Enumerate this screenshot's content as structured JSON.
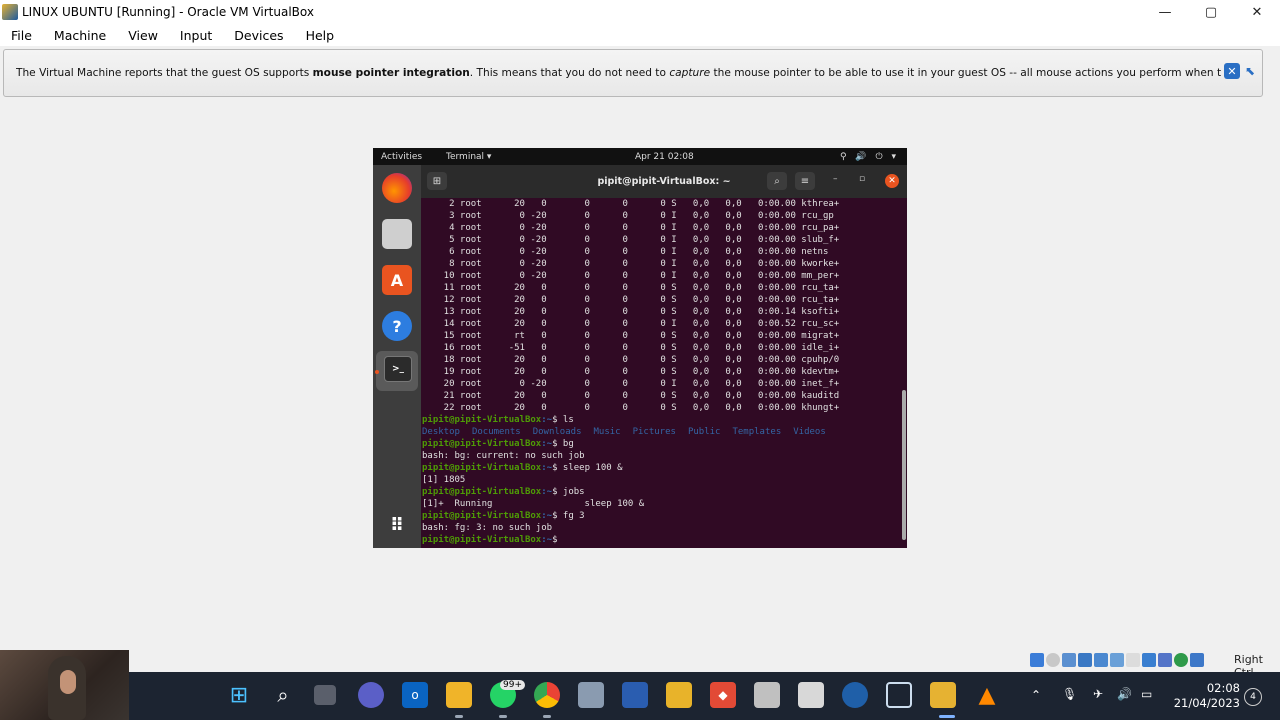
{
  "window": {
    "title": "LINUX UBUNTU [Running] - Oracle VM VirtualBox",
    "controls": [
      "—",
      "▢",
      "✕"
    ]
  },
  "menu": [
    "File",
    "Machine",
    "View",
    "Input",
    "Devices",
    "Help"
  ],
  "notification": {
    "part1": "The Virtual Machine reports that the guest OS supports ",
    "bold": "mouse pointer integration",
    "part2": ". This means that you do not need to ",
    "italic": "capture",
    "part3": " the mouse pointer to be able to use it in your guest OS -- all mouse actions you perform when the mouse pointer is over"
  },
  "guest": {
    "topbar": {
      "activities": "Activities",
      "app": "Terminal ▾",
      "clock": "Apr 21  02:08",
      "sys": "⚲ 🔊 ⏻ ▾"
    },
    "terminal": {
      "title": "pipit@pipit-VirtualBox: ~",
      "process_lines": [
        "     2 root      20   0       0      0      0 S   0,0   0,0   0:00.00 kthrea+",
        "     3 root       0 -20       0      0      0 I   0,0   0,0   0:00.00 rcu_gp",
        "     4 root       0 -20       0      0      0 I   0,0   0,0   0:00.00 rcu_pa+",
        "     5 root       0 -20       0      0      0 I   0,0   0,0   0:00.00 slub_f+",
        "     6 root       0 -20       0      0      0 I   0,0   0,0   0:00.00 netns",
        "     8 root       0 -20       0      0      0 I   0,0   0,0   0:00.00 kworke+",
        "    10 root       0 -20       0      0      0 I   0,0   0,0   0:00.00 mm_per+",
        "    11 root      20   0       0      0      0 S   0,0   0,0   0:00.00 rcu_ta+",
        "    12 root      20   0       0      0      0 S   0,0   0,0   0:00.00 rcu_ta+",
        "    13 root      20   0       0      0      0 S   0,0   0,0   0:00.14 ksofti+",
        "    14 root      20   0       0      0      0 I   0,0   0,0   0:00.52 rcu_sc+",
        "    15 root      rt   0       0      0      0 S   0,0   0,0   0:00.00 migrat+",
        "    16 root     -51   0       0      0      0 S   0,0   0,0   0:00.00 idle_i+",
        "    18 root      20   0       0      0      0 S   0,0   0,0   0:00.00 cpuhp/0",
        "    19 root      20   0       0      0      0 S   0,0   0,0   0:00.00 kdevtm+",
        "    20 root       0 -20       0      0      0 I   0,0   0,0   0:00.00 inet_f+",
        "    21 root      20   0       0      0      0 S   0,0   0,0   0:00.00 kauditd",
        "    22 root      20   0       0      0      0 S   0,0   0,0   0:00.00 khungt+"
      ],
      "prompt_user": "pipit@pipit-VirtualBox",
      "prompt_path": ":~",
      "prompt_sign": "$ ",
      "cmd_ls": "ls",
      "ls_dirs": [
        "Desktop",
        "Documents",
        "Downloads",
        "Music",
        "Pictures",
        "Public",
        "Templates",
        "Videos"
      ],
      "cmd_bg": "bg",
      "out_bg": "bash: bg: current: no such job",
      "cmd_sleep": "sleep 100 &",
      "out_sleep": "[1] 1805",
      "cmd_jobs": "jobs",
      "out_jobs": "[1]+  Running                 sleep 100 &",
      "cmd_fg": "fg 3",
      "out_fg": "bash: fg: 3: no such job"
    }
  },
  "vb_status": {
    "right_ctrl": "Right Ctrl"
  },
  "taskbar": {
    "whatsapp_badge": "99+",
    "time": "02:08",
    "date": "21/04/2023",
    "notifications": "4"
  }
}
